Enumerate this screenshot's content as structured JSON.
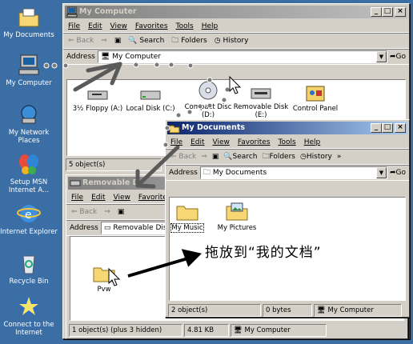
{
  "desktop": {
    "icons": [
      {
        "label": "My Documents",
        "icon": "folder-documents-icon"
      },
      {
        "label": "My Computer",
        "icon": "computer-icon"
      },
      {
        "label": "My Network Places",
        "icon": "network-icon"
      },
      {
        "label": "Setup MSN Internet A...",
        "icon": "msn-butterfly-icon"
      },
      {
        "label": "Internet Explorer",
        "icon": "ie-icon"
      },
      {
        "label": "Recycle Bin",
        "icon": "recycle-bin-icon"
      },
      {
        "label": "Connect to the Internet",
        "icon": "connect-icon"
      }
    ]
  },
  "win_computer": {
    "title": "My Computer",
    "menu": [
      "File",
      "Edit",
      "View",
      "Favorites",
      "Tools",
      "Help"
    ],
    "toolbar": {
      "back": "Back",
      "search": "Search",
      "folders": "Folders",
      "history": "History"
    },
    "address_label": "Address",
    "address_value": "My Computer",
    "go": "Go",
    "items": [
      {
        "label": "3½ Floppy (A:)",
        "icon": "floppy-drive-icon"
      },
      {
        "label": "Local Disk (C:)",
        "icon": "hard-disk-icon"
      },
      {
        "label": "Compact Disc (D:)",
        "icon": "cd-drive-icon"
      },
      {
        "label": "Removable Disk (E:)",
        "icon": "removable-disk-icon"
      },
      {
        "label": "Control Panel",
        "icon": "control-panel-icon"
      }
    ],
    "status": "5 object(s)"
  },
  "win_removable": {
    "title": "Removable Disk (E:)",
    "title_visible": "Removable D",
    "menu": [
      "File",
      "Edit",
      "View",
      "Favorites"
    ],
    "toolbar": {
      "back": "Back"
    },
    "address_label": "Address",
    "address_value": "Removable Disk",
    "items": [
      {
        "label": "Pvw",
        "icon": "folder-icon"
      }
    ],
    "status": [
      "1 object(s) (plus 3 hidden)",
      "4.81 KB",
      "My Computer"
    ]
  },
  "win_documents": {
    "title": "My Documents",
    "menu": [
      "File",
      "Edit",
      "View",
      "Favorites",
      "Tools",
      "Help"
    ],
    "toolbar": {
      "back": "Back",
      "search": "Search",
      "folders": "Folders",
      "history": "History",
      "more": "»"
    },
    "address_label": "Address",
    "address_value": "My Documents",
    "go": "Go",
    "items": [
      {
        "label": "My Music",
        "icon": "folder-icon"
      },
      {
        "label": "My Pictures",
        "icon": "pictures-folder-icon"
      }
    ],
    "status": [
      "2 object(s)",
      "0 bytes",
      "My Computer"
    ]
  },
  "annotation": "拖放到“我的文档”",
  "colors": {
    "desktop": "#3a6ea5",
    "title_active": "#0a246a",
    "arrow": "#5a5a5a"
  }
}
